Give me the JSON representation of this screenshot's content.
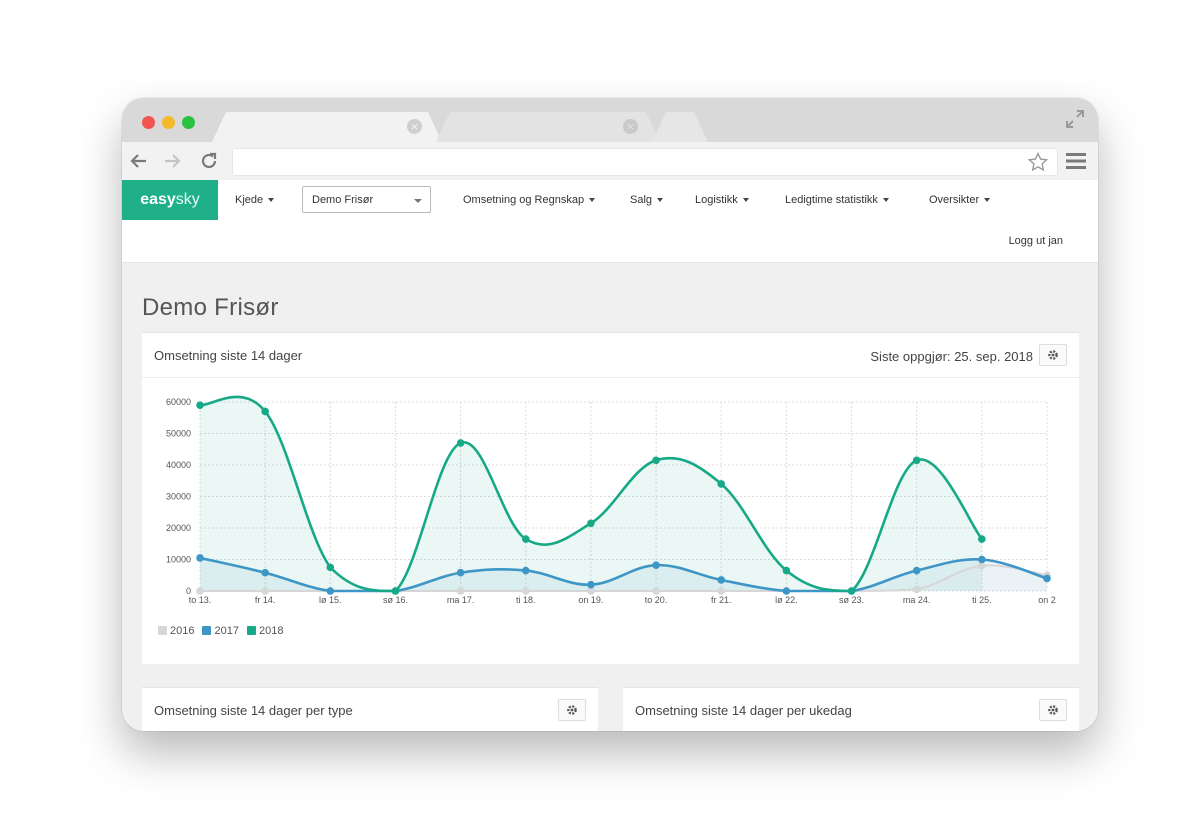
{
  "colors": {
    "brand": "#1fb08a",
    "series_2016": "#d6d6d6",
    "series_2017": "#3e96c6",
    "series_2018": "#17a987"
  },
  "nav": {
    "brand_bold": "easy",
    "brand_light": "sky",
    "kjede": "Kjede",
    "store": "Demo Frisør",
    "omsetning": "Omsetning og Regnskap",
    "salg": "Salg",
    "logistikk": "Logistikk",
    "ledigtime": "Ledigtime statistikk",
    "oversikter": "Oversikter",
    "logout": "Logg ut jan"
  },
  "page": {
    "title": "Demo Frisør"
  },
  "panel_main": {
    "title": "Omsetning siste 14 dager",
    "meta": "Siste oppgjør: 25. sep. 2018"
  },
  "panel_type": {
    "title": "Omsetning siste 14 dager per type"
  },
  "panel_weekday": {
    "title": "Omsetning siste 14 dager per ukedag"
  },
  "chart_data": {
    "type": "area",
    "categories": [
      "to 13.",
      "fr 14.",
      "lø 15.",
      "sø 16.",
      "ma 17.",
      "ti 18.",
      "on 19.",
      "to 20.",
      "fr 21.",
      "lø 22.",
      "sø 23.",
      "ma 24.",
      "ti 25.",
      "on 2"
    ],
    "y_ticks": [
      "0",
      "10000",
      "20000",
      "30000",
      "40000",
      "50000",
      "60000"
    ],
    "ylim": [
      0,
      60000
    ],
    "grid": true,
    "legend": "bottom-left",
    "series": [
      {
        "name": "2016",
        "values": [
          0,
          0,
          0,
          0,
          0,
          0,
          0,
          0,
          0,
          0,
          0,
          500,
          8000,
          5000
        ]
      },
      {
        "name": "2017",
        "values": [
          10500,
          5800,
          0,
          0,
          5800,
          6500,
          2000,
          8200,
          3500,
          0,
          0,
          6500,
          10000,
          4000
        ]
      },
      {
        "name": "2018",
        "values": [
          59000,
          57000,
          7500,
          0,
          47000,
          16500,
          21500,
          41500,
          34000,
          6500,
          0,
          41500,
          16500,
          null
        ]
      }
    ]
  }
}
